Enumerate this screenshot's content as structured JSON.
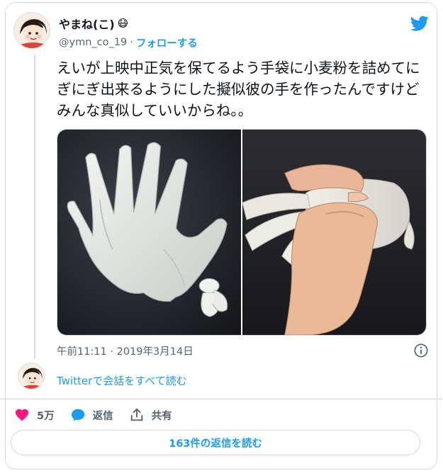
{
  "user": {
    "display_name": "やまね(こ)",
    "handle": "@ymn_co_19",
    "separator": "·",
    "follow_label": "フォローする"
  },
  "tweet": {
    "text": "えいが上映中正気を保てるよう手袋に小麦粉を詰めてにぎにぎ出来るようにした擬似彼の手を作ったんですけどみんな真似していいからね。。",
    "timestamp": "午前11:11 · 2019年3月14日"
  },
  "thread": {
    "read_conversation": "Twitterで会話をすべて読む"
  },
  "actions": {
    "likes": "5万",
    "reply_label": "返信",
    "share_label": "共有"
  },
  "replies_button": "163件の返信を読む",
  "colors": {
    "accent": "#1d9bf0",
    "like": "#f91880",
    "muted": "#536471",
    "border": "#cfd9de"
  }
}
